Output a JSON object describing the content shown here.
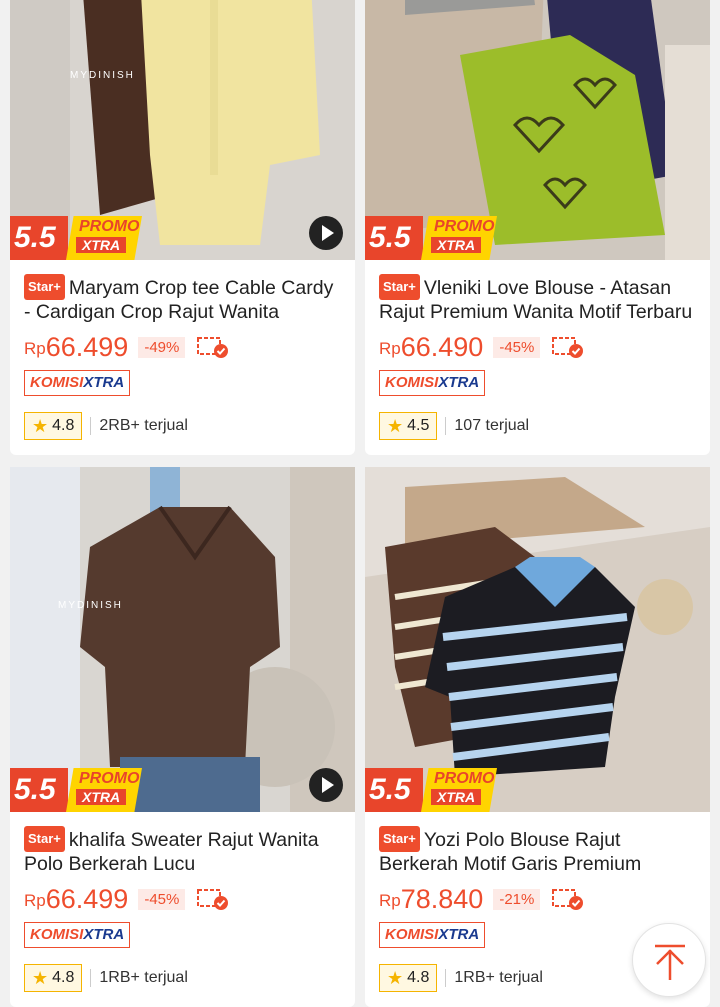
{
  "promo": {
    "number": "5.5",
    "promo_label": "PROMO",
    "xtra_label": "XTRA"
  },
  "badges": {
    "star_plus": "Star+",
    "komisi_part1": "KOMISI",
    "komisi_part2": "XTRA"
  },
  "products": [
    {
      "title": "Maryam Crop tee Cable Cardy - Cardigan Crop Rajut Wanita",
      "currency": "Rp",
      "price": "66.499",
      "discount": "-49%",
      "rating": "4.8",
      "sold": "2RB+ terjual",
      "has_video": true
    },
    {
      "title": "Vleniki Love Blouse - Atasan Rajut Premium Wanita Motif Terbaru",
      "currency": "Rp",
      "price": "66.490",
      "discount": "-45%",
      "rating": "4.5",
      "sold": "107 terjual",
      "has_video": false
    },
    {
      "title": "khalifa Sweater Rajut Wanita Polo Berkerah Lucu",
      "currency": "Rp",
      "price": "66.499",
      "discount": "-45%",
      "rating": "4.8",
      "sold": "1RB+ terjual",
      "has_video": true
    },
    {
      "title": "Yozi Polo Blouse Rajut Berkerah Motif Garis Premium",
      "currency": "Rp",
      "price": "78.840",
      "discount": "-21%",
      "rating": "4.8",
      "sold": "1RB+ terjual",
      "has_video": false
    }
  ],
  "colors": {
    "accent": "#ee4d2d",
    "promo_yellow": "#ffd400",
    "star": "#f5b400"
  },
  "icons": [
    "play-icon",
    "cod-voucher-icon",
    "star-icon",
    "back-to-top-icon"
  ]
}
